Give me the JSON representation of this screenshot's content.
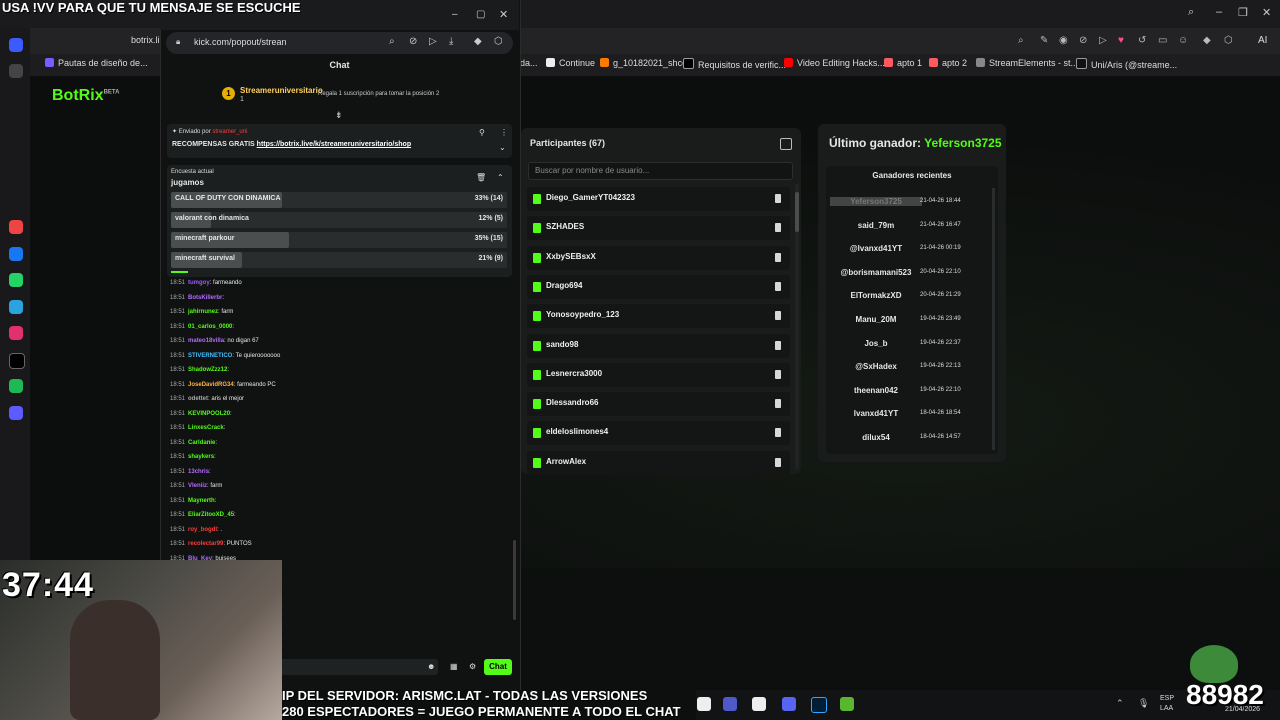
{
  "overlay": {
    "top_text": "USA !VV PARA QUE TU MENSAJE SE ESCUCHE",
    "timer": "37:44",
    "ticker_line1": "IP DEL SERVIDOR: ARISMC.LAT - TODAS LAS VERSIONES",
    "ticker_line2": "280 ESPECTADORES = JUEGO PERMANENTE A TODO EL CHAT",
    "counter": "88982"
  },
  "background_browser": {
    "tab_partial": "botrix.li",
    "bookmarks": [
      "Pautas de diseño de...",
      "da...",
      "Continue",
      "g_10182021_shcc",
      "Requisitos de verific...",
      "Video Editing Hacks...",
      "apto 1",
      "apto 2",
      "StreamElements - st...",
      "Uni/Aris (@streame..."
    ],
    "ai_label": "AI"
  },
  "botrix": {
    "logo": "BotRix",
    "logo_badge": "BETA",
    "participants": {
      "title": "Participantes (67)",
      "search_placeholder": "Buscar por nombre de usuario...",
      "users": [
        "Diego_GamerYT042323",
        "SZHADES",
        "XxbySEBsxX",
        "Drago694",
        "Yonosoypedro_123",
        "sando98",
        "Lesnercra3000",
        "Dlessandro66",
        "eldeloslimones4",
        "ArrowAlex"
      ]
    },
    "winner": {
      "label": "Último ganador:",
      "name": "Yeferson3725",
      "recent_title": "Ganadores recientes",
      "recent": [
        {
          "name": "Yeferson3725",
          "date": "21-04-26 18:44"
        },
        {
          "name": "said_79m",
          "date": "21-04-26 16:47"
        },
        {
          "name": "@lvanxd41YT",
          "date": "21-04-26 00:19"
        },
        {
          "name": "@borismamani523",
          "date": "20-04-26 22:10"
        },
        {
          "name": "ElTormakzXD",
          "date": "20-04-26 21:29"
        },
        {
          "name": "Manu_20M",
          "date": "19-04-26 23:49"
        },
        {
          "name": "Jos_b",
          "date": "19-04-26 22:37"
        },
        {
          "name": "@SxHadex",
          "date": "19-04-26 22:13"
        },
        {
          "name": "theenan042",
          "date": "19-04-26 22:10"
        },
        {
          "name": "lvanxd41YT",
          "date": "18-04-26 18:54"
        },
        {
          "name": "dilux54",
          "date": "18-04-26 14:57"
        }
      ]
    }
  },
  "popout": {
    "url": "kick.com/popout/strean",
    "chat_title": "Chat",
    "sub": {
      "badge": "1",
      "name": "Streameruniversitario",
      "count": "1",
      "note": "Regala 1 suscripción para tomar la posición 2"
    },
    "pinned": {
      "by_label": "Enviado por",
      "by_user": "streamer_uni",
      "text": "RECOMPENSAS GRATIS",
      "link": "https://botrix.live/k/streameruniversitario/shop"
    },
    "poll": {
      "label": "Encuesta actual",
      "question": "jugamos",
      "options": [
        {
          "text": "CALL OF DUTY CON DINAMICA",
          "pct": "33% (14)",
          "fill": 0.33
        },
        {
          "text": "valorant con dinamica",
          "pct": "12% (5)",
          "fill": 0.12
        },
        {
          "text": "minecraft parkour",
          "pct": "35% (15)",
          "fill": 0.35
        },
        {
          "text": "minecraft survival",
          "pct": "21% (9)",
          "fill": 0.21
        }
      ]
    },
    "messages": [
      {
        "time": "18:51",
        "user": "tumgoy",
        "color": "#9b59ff",
        "text": "farmeando"
      },
      {
        "time": "18:51",
        "user": "BotsKillerbr",
        "color": "#b36bff",
        "text": ""
      },
      {
        "time": "18:51",
        "user": "jahirnunez",
        "color": "#53fc18",
        "text": "farm"
      },
      {
        "time": "18:51",
        "user": "01_carlos_0000",
        "color": "#53fc18",
        "text": ""
      },
      {
        "time": "18:51",
        "user": "mateo18villa",
        "color": "#b36bff",
        "text": "no digan 67"
      },
      {
        "time": "18:51",
        "user": "STIVERNETICO",
        "color": "#3fc1ff",
        "text": "Te quierooooooo"
      },
      {
        "time": "18:51",
        "user": "ShadowZzz12",
        "color": "#53fc18",
        "text": ""
      },
      {
        "time": "18:51",
        "user": "JoseDavidRG34",
        "color": "#ffb347",
        "text": "farmeando PC"
      },
      {
        "time": "18:51",
        "user": "odettet",
        "color": "#aaaaaa",
        "text": "aris el mejor"
      },
      {
        "time": "18:51",
        "user": "KEVINPOOL20",
        "color": "#53fc18",
        "text": ""
      },
      {
        "time": "18:51",
        "user": "LinxesCrack",
        "color": "#53fc18",
        "text": ""
      },
      {
        "time": "18:51",
        "user": "Carldanie",
        "color": "#53fc18",
        "text": ""
      },
      {
        "time": "18:51",
        "user": "shaykers",
        "color": "#53fc18",
        "text": ""
      },
      {
        "time": "18:51",
        "user": "13chris",
        "color": "#b36bff",
        "text": ""
      },
      {
        "time": "18:51",
        "user": "Vleniiz",
        "color": "#b36bff",
        "text": "farm"
      },
      {
        "time": "18:51",
        "user": "Maynerth",
        "color": "#53fc18",
        "text": ""
      },
      {
        "time": "18:51",
        "user": "EliarZitooXD_45",
        "color": "#53fc18",
        "text": ""
      },
      {
        "time": "18:51",
        "user": "roy_bogdl",
        "color": "#ff3d3d",
        "text": "."
      },
      {
        "time": "18:51",
        "user": "recolectar99",
        "color": "#ff3d3d",
        "text": "PUNTOS"
      },
      {
        "time": "18:51",
        "user": "Blu_Key",
        "color": "#b36bff",
        "text": "buisees"
      }
    ],
    "send_label": "Chat"
  },
  "taskbar": {
    "lang1": "ESP",
    "lang2": "LAA",
    "date": "21/04/2026"
  }
}
